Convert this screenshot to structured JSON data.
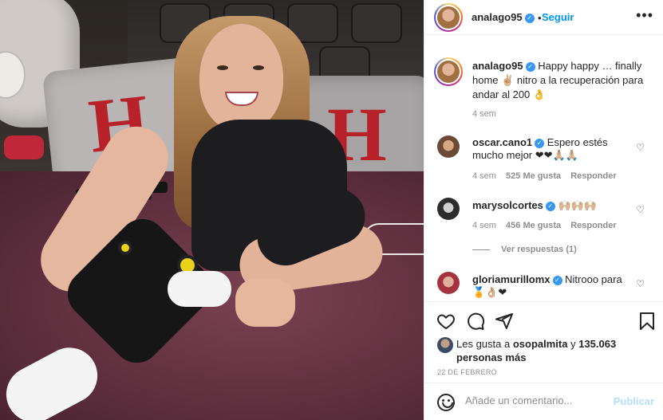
{
  "post": {
    "author": "analago95",
    "follow_label": "Seguir",
    "dot": "•",
    "more_label": "•••",
    "caption": "Happy happy … finally home ✌🏼 nitro a la recuperación para andar al 200 👌",
    "caption_time": "4 sem"
  },
  "comments": [
    {
      "user": "oscar.cano1",
      "verified": true,
      "text": "Espero estés mucho mejor ❤❤🙏🏼🙏🏼",
      "time": "4 sem",
      "likes": "525 Me gusta",
      "reply": "Responder"
    },
    {
      "user": "marysolcortes",
      "verified": true,
      "text": "🙌🏼🙌🏼🙌🏼",
      "time": "4 sem",
      "likes": "456 Me gusta",
      "reply": "Responder",
      "view_replies": "Ver respuestas (1)"
    },
    {
      "user": "gloriamurillomx",
      "verified": true,
      "text": "Nitrooo para 🏅👌🏼❤",
      "time": "",
      "likes": "",
      "reply": ""
    }
  ],
  "likes": {
    "prefix": "Les gusta a",
    "liker": "osopalmita",
    "middle": "y",
    "count": "135.063 personas más"
  },
  "date": "22 DE FEBRERO",
  "add_comment": {
    "placeholder": "Añade un comentario...",
    "publish_label": "Publicar"
  },
  "icons": {
    "like": "heart-icon",
    "comment": "comment-icon",
    "share": "share-icon",
    "save": "bookmark-icon",
    "emoji": "emoji-icon",
    "verified": "verified-badge-icon",
    "more": "more-options-icon"
  },
  "colors": {
    "link_blue": "#0095f6",
    "verified_blue": "#3897f0",
    "muted": "#8e8e8e",
    "publish_disabled": "#b2dffc"
  }
}
